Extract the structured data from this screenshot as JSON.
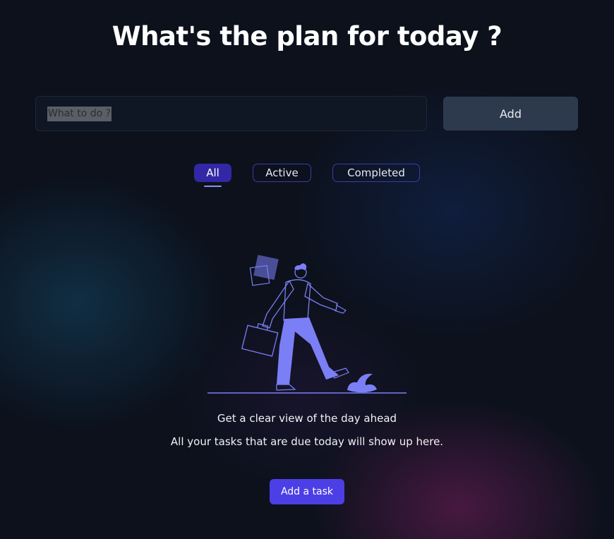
{
  "header": {
    "title": "What's the plan for today ?"
  },
  "task_form": {
    "input_value": "",
    "input_placeholder": "What to do ?",
    "add_label": "Add"
  },
  "filters": {
    "tabs": [
      {
        "label": "All",
        "selected": true
      },
      {
        "label": "Active",
        "selected": false
      },
      {
        "label": "Completed",
        "selected": false
      }
    ]
  },
  "empty_state": {
    "illustration": "person-walking-with-briefcase-illustration",
    "heading": "Get a clear view of the day ahead",
    "subtext": "All your tasks that are due today will show up here.",
    "cta_label": "Add a task"
  },
  "colors": {
    "background": "#0c111c",
    "primary": "#4c3fe6",
    "tab_active": "#3228a6",
    "tab_border": "#3a3bb0",
    "illustration": "#7b7ff5",
    "secondary_button": "#2d3a4e"
  }
}
